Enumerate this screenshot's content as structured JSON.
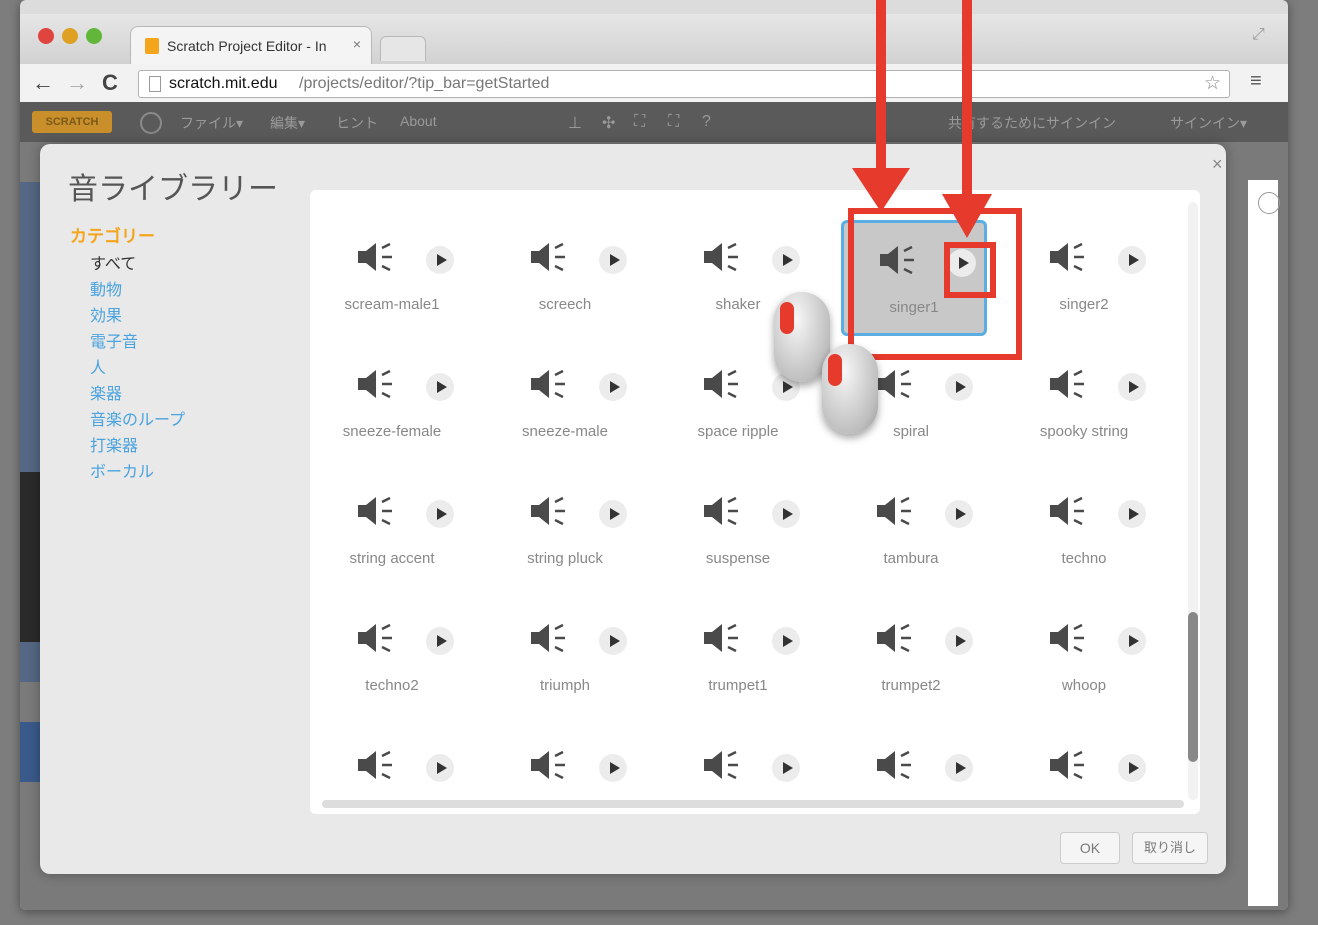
{
  "browser": {
    "tab_title": "Scratch Project Editor - In",
    "tab_close": "×",
    "url_host": "scratch.mit.edu",
    "url_path": "/projects/editor/?tip_bar=getStarted"
  },
  "scratch_menu": {
    "logo": "SCRATCH",
    "file": "ファイル▾",
    "edit": "編集▾",
    "tips": "ヒント",
    "about": "About",
    "share": "共有するためにサインイン",
    "signin": "サインイン▾"
  },
  "dialog": {
    "title": "音ライブラリー",
    "close": "×",
    "category_heading": "カテゴリー",
    "categories": [
      "すべて",
      "動物",
      "効果",
      "電子音",
      "人",
      "楽器",
      "音楽のループ",
      "打楽器",
      "ボーカル"
    ],
    "sounds": [
      "scream-male1",
      "screech",
      "shaker",
      "singer1",
      "singer2",
      "sneeze-female",
      "sneeze-male",
      "space ripple",
      "spiral",
      "spooky string",
      "string accent",
      "string pluck",
      "suspense",
      "tambura",
      "techno",
      "techno2",
      "triumph",
      "trumpet1",
      "trumpet2",
      "whoop",
      "",
      "",
      "",
      "",
      ""
    ],
    "selected_sound": "singer1",
    "ok": "OK",
    "cancel": "取り消し"
  },
  "colors": {
    "annotation_red": "#e53a2c",
    "selection_blue": "#5aaee2",
    "category_heading": "#f4a51c",
    "category_link": "#4aa3df"
  }
}
